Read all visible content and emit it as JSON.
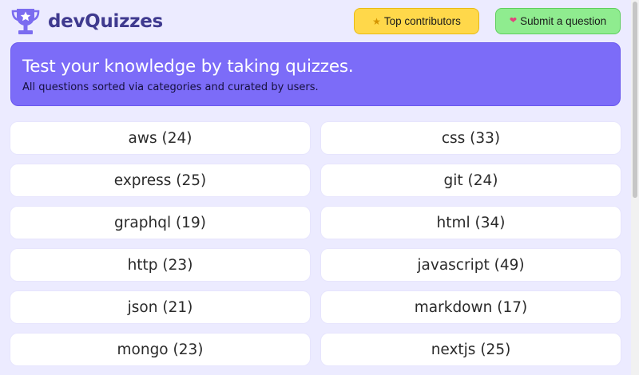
{
  "header": {
    "logo_text": "devQuizzes",
    "logo_icon": "trophy-star-icon",
    "top_contributors_label": "Top contributors",
    "top_contributors_icon": "medal-icon",
    "submit_question_label": "Submit a question",
    "submit_question_icon": "heart-icon"
  },
  "hero": {
    "title": "Test your knowledge by taking quizzes.",
    "subtitle": "All questions sorted via categories and curated by users."
  },
  "categories": [
    {
      "label": "aws (24)"
    },
    {
      "label": "css (33)"
    },
    {
      "label": "express (25)"
    },
    {
      "label": "git (24)"
    },
    {
      "label": "graphql (19)"
    },
    {
      "label": "html (34)"
    },
    {
      "label": "http (23)"
    },
    {
      "label": "javascript (49)"
    },
    {
      "label": "json (21)"
    },
    {
      "label": "markdown (17)"
    },
    {
      "label": "mongo (23)"
    },
    {
      "label": "nextjs (25)"
    }
  ],
  "colors": {
    "background": "#ecebff",
    "brand": "#3f3a8f",
    "hero": "#7c6cf8",
    "contrib_button": "#ffd84a",
    "submit_button": "#8fec8f"
  }
}
